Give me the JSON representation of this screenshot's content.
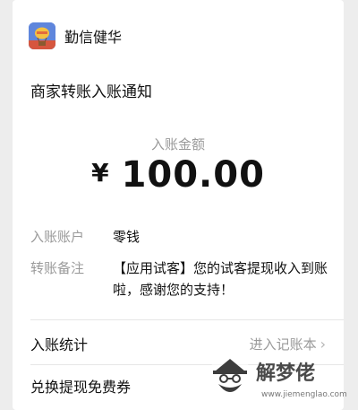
{
  "app": {
    "name": "勤信健华"
  },
  "notice": {
    "title": "商家转账入账通知",
    "amount_label": "入账金额",
    "currency_symbol": "¥",
    "amount": "100.00"
  },
  "details": [
    {
      "key": "入账账户",
      "value": "零钱"
    },
    {
      "key": "转账备注",
      "value": "【应用试客】您的试客提现收入到账啦，感谢您的支持！"
    }
  ],
  "stats": {
    "label": "入账统计",
    "link": "进入记账本",
    "chevron": "›"
  },
  "coupon": {
    "label": "兑换提现免费券"
  },
  "watermark": {
    "text": "解梦佬",
    "url": "www.jiemenglao.com"
  },
  "icons": {
    "app_icon": "hot-air-balloon-app-icon",
    "chevron": "chevron-right-icon",
    "watermark_logo": "bearded-man-logo-icon"
  },
  "colors": {
    "background": "#ededed",
    "card": "#ffffff",
    "primary_text": "#111111",
    "secondary_text": "#9a9a9a"
  }
}
